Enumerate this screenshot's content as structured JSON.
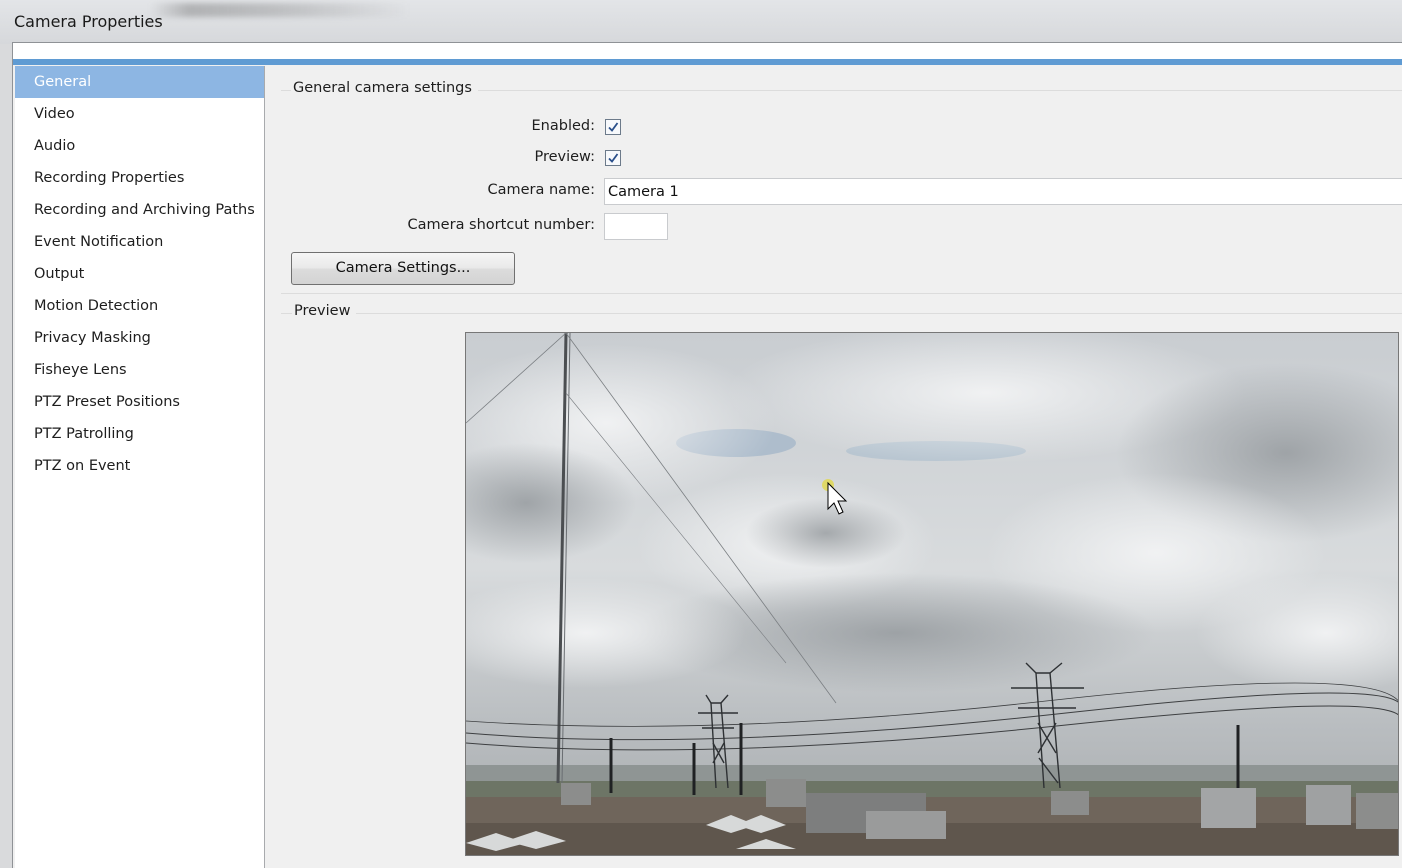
{
  "window": {
    "title": "Camera Properties"
  },
  "sidebar": {
    "items": [
      {
        "label": "General",
        "selected": true
      },
      {
        "label": "Video"
      },
      {
        "label": "Audio"
      },
      {
        "label": "Recording Properties"
      },
      {
        "label": "Recording and Archiving Paths"
      },
      {
        "label": "Event Notification"
      },
      {
        "label": "Output"
      },
      {
        "label": "Motion Detection"
      },
      {
        "label": "Privacy Masking"
      },
      {
        "label": "Fisheye Lens"
      },
      {
        "label": "PTZ Preset Positions"
      },
      {
        "label": "PTZ Patrolling"
      },
      {
        "label": "PTZ on Event"
      }
    ]
  },
  "general": {
    "group_title": "General camera settings",
    "enabled_label": "Enabled:",
    "enabled_checked": true,
    "preview_label": "Preview:",
    "preview_checked": true,
    "camera_name_label": "Camera name:",
    "camera_name_value": "Camera 1",
    "shortcut_label": "Camera shortcut number:",
    "shortcut_value": "",
    "camera_settings_button": "Camera Settings..."
  },
  "preview": {
    "group_title": "Preview",
    "image_icon": "camera-live-feed"
  },
  "colors": {
    "accent": "#5f9bd3",
    "selected_item": "#8db6e3",
    "checkmark": "#2a4f8a"
  }
}
